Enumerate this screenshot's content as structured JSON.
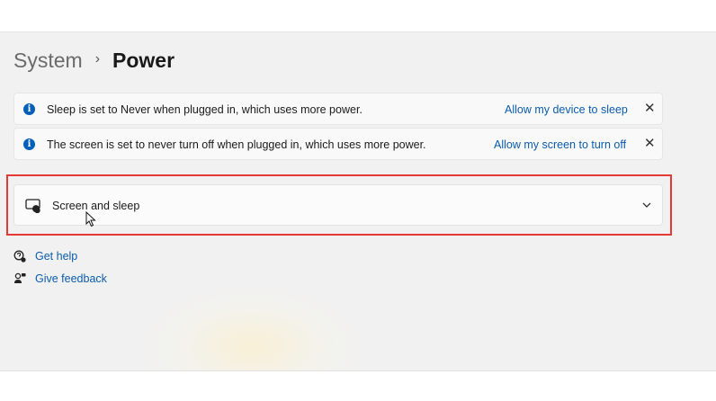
{
  "breadcrumb": {
    "parent": "System",
    "separator": "›",
    "current": "Power"
  },
  "notifications": [
    {
      "message": "Sleep is set to Never when plugged in, which uses more power.",
      "link": "Allow my device to sleep",
      "close": "✕"
    },
    {
      "message": "The screen is set to never turn off when plugged in, which uses more power.",
      "link": "Allow my screen to turn off",
      "close": "✕"
    }
  ],
  "screen_sleep": {
    "title": "Screen and sleep",
    "icon": "screen-sleep-icon",
    "expand_icon": "chevron-down-icon"
  },
  "help_links": [
    {
      "label": "Get help",
      "icon": "help-icon"
    },
    {
      "label": "Give feedback",
      "icon": "feedback-icon"
    }
  ],
  "colors": {
    "accent": "#005fb8",
    "link": "#0b5cad",
    "highlight": "#e53935",
    "background": "#f1f1f1"
  }
}
